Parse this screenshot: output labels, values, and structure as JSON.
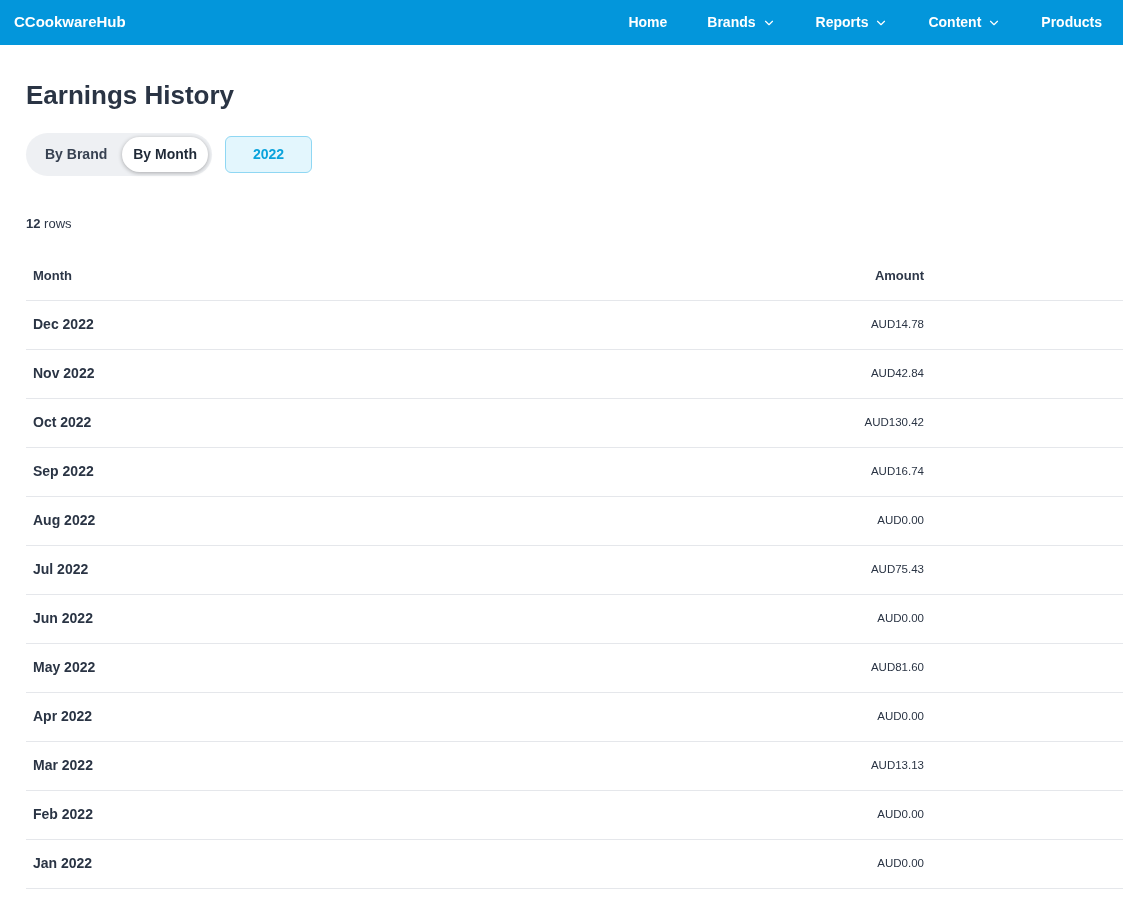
{
  "navbar": {
    "brand": "CCookwareHub",
    "items": [
      {
        "label": "Home",
        "dropdown": false
      },
      {
        "label": "Brands",
        "dropdown": true
      },
      {
        "label": "Reports",
        "dropdown": true
      },
      {
        "label": "Content",
        "dropdown": true
      },
      {
        "label": "Products",
        "dropdown": false
      }
    ]
  },
  "title": "Earnings History",
  "view_toggle": [
    {
      "label": "By Brand",
      "selected": false
    },
    {
      "label": "By Month",
      "selected": true
    }
  ],
  "year_button": "2022",
  "row_count": "**12** rows",
  "table": {
    "columns": [
      "Month",
      "Amount"
    ],
    "rows": [
      [
        "Dec 2022",
        "AUD14.78"
      ],
      [
        "Nov 2022",
        "AUD42.84"
      ],
      [
        "Oct 2022",
        "AUD130.42"
      ],
      [
        "Sep 2022",
        "AUD16.74"
      ],
      [
        "Aug 2022",
        "AUD0.00"
      ],
      [
        "Jul 2022",
        "AUD75.43"
      ],
      [
        "Jun 2022",
        "AUD0.00"
      ],
      [
        "May 2022",
        "AUD81.60"
      ],
      [
        "Apr 2022",
        "AUD0.00"
      ],
      [
        "Mar 2022",
        "AUD13.13"
      ],
      [
        "Feb 2022",
        "AUD0.00"
      ],
      [
        "Jan 2022",
        "AUD0.00"
      ]
    ]
  }
}
